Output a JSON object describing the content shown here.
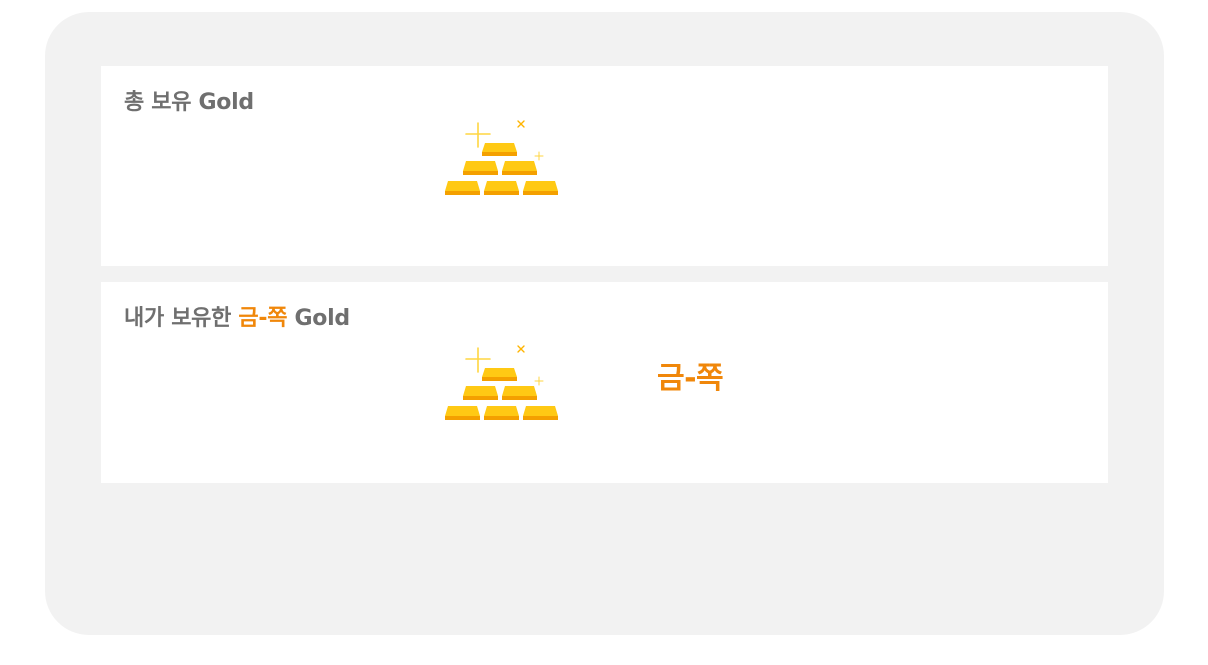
{
  "total": {
    "title_prefix": "총 보유",
    "title_suffix": "Gold",
    "icon": "gold-bars-icon"
  },
  "mine": {
    "title_prefix": "내가 보유한",
    "title_highlight": "금-쪽",
    "title_suffix": "Gold",
    "icon": "gold-bars-icon",
    "value": "금-쪽"
  },
  "colors": {
    "accent": "#f0870a",
    "title": "#6f6f6f",
    "frame_bg": "#f2f2f2",
    "card_bg": "#ffffff"
  }
}
